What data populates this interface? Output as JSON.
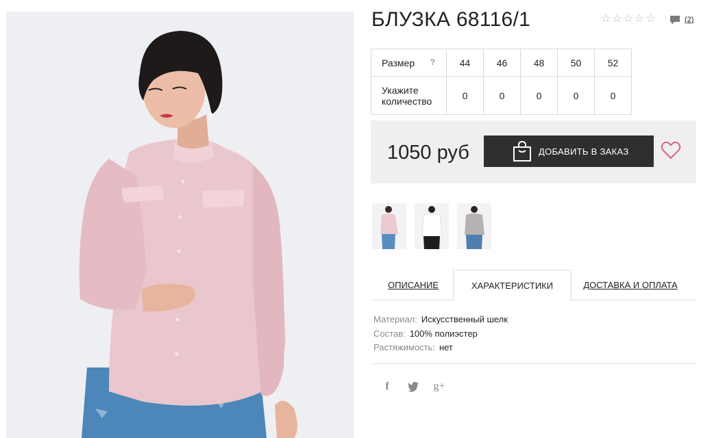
{
  "product": {
    "title": "БЛУЗКА 68116/1",
    "rating": {
      "stars": [
        "☆",
        "☆",
        "☆",
        "☆",
        "☆"
      ],
      "value": 0,
      "max": 5
    },
    "comments_count": "(2)"
  },
  "sizes": {
    "label": "Размер",
    "help": "?",
    "values": [
      "44",
      "46",
      "48",
      "50",
      "52"
    ],
    "qty_label_line1": "Укажите",
    "qty_label_line2": "количество",
    "quantities": [
      "0",
      "0",
      "0",
      "0",
      "0"
    ]
  },
  "purchase": {
    "price": "1050 руб",
    "add_to_cart": "ДОБАВИТЬ В ЗАКАЗ"
  },
  "thumbnails": [
    "pink-blouse",
    "white-blouse",
    "grey-blouse"
  ],
  "tabs": {
    "description": "ОПИСАНИЕ",
    "characteristics": "ХАРАКТЕРИСТИКИ",
    "delivery": "ДОСТАВКА И ОПЛАТА",
    "active": "characteristics"
  },
  "specs": [
    {
      "key": "Материал:",
      "value": "Искусственный шелк"
    },
    {
      "key": "Состав:",
      "value": "100% полиэстер"
    },
    {
      "key": "Растяжимость:",
      "value": "нет"
    }
  ],
  "social": {
    "facebook": "f",
    "twitter": "twitter-icon",
    "googleplus": "g+"
  },
  "colors": {
    "accent_dark": "#2f2f2f",
    "heart": "#d9607f",
    "panel": "#efefef"
  }
}
